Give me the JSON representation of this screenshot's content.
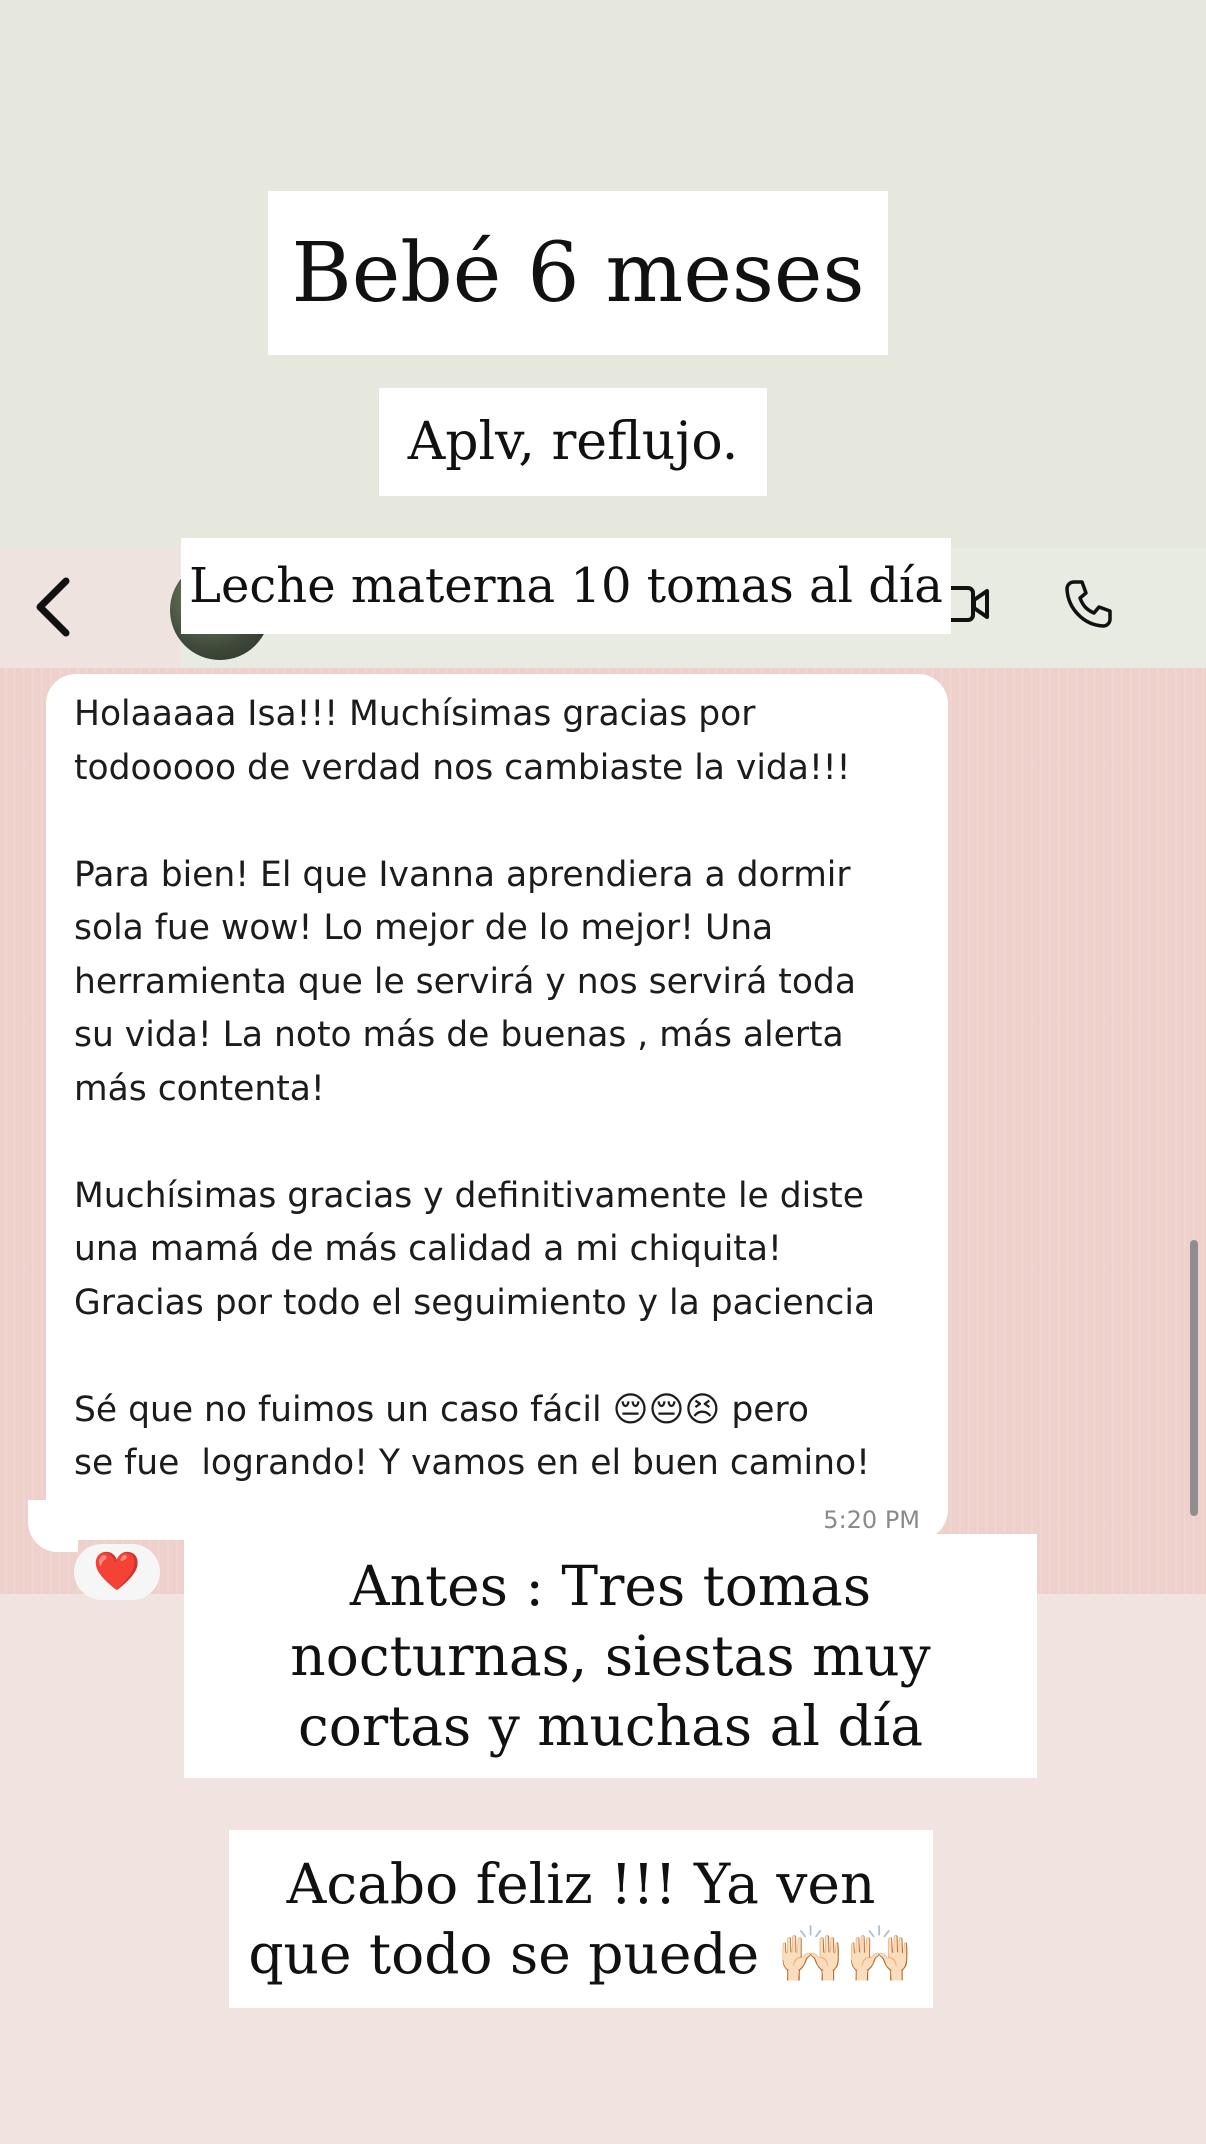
{
  "captions": {
    "title": "Bebé 6 meses",
    "subtitle": "Aplv, reflujo.",
    "feeding": "Leche materna 10 tomas al día",
    "before": "Antes : Tres tomas nocturnas, siestas muy cortas y muchas al día",
    "ending": "Acabo feliz !!! Ya ven que todo se puede 🙌🏻🙌🏻"
  },
  "chat_header": {
    "back_icon": "chevron-left-icon",
    "avatar": "contact-avatar",
    "video_icon": "video-camera-icon",
    "phone_icon": "phone-icon"
  },
  "message": {
    "text": "Holaaaaa Isa!!! Muchísimas gracias por\ntodooooo de verdad nos cambiaste la vida!!!\n\nPara bien! El que Ivanna aprendiera a dormir\nsola fue wow! Lo mejor de lo mejor! Una\nherramienta que le servirá y nos servirá toda\nsu vida! La noto más de buenas , más alerta\nmás contenta!\n\nMuchísimas gracias y definitivamente le diste\nuna mamá de más calidad a mi chiquita!\nGracias por todo el seguimiento y la paciencia\n\nSé que no fuimos un caso fácil 😔😔😣 pero\nse fue  logrando! Y vamos en el buen camino!",
    "time": "5:20 PM",
    "reaction": "❤️"
  },
  "colors": {
    "top_background": "#e6e8de",
    "chat_background": "#efd3cf",
    "bottom_background": "#f1e3e0",
    "bubble": "#ffffff"
  }
}
